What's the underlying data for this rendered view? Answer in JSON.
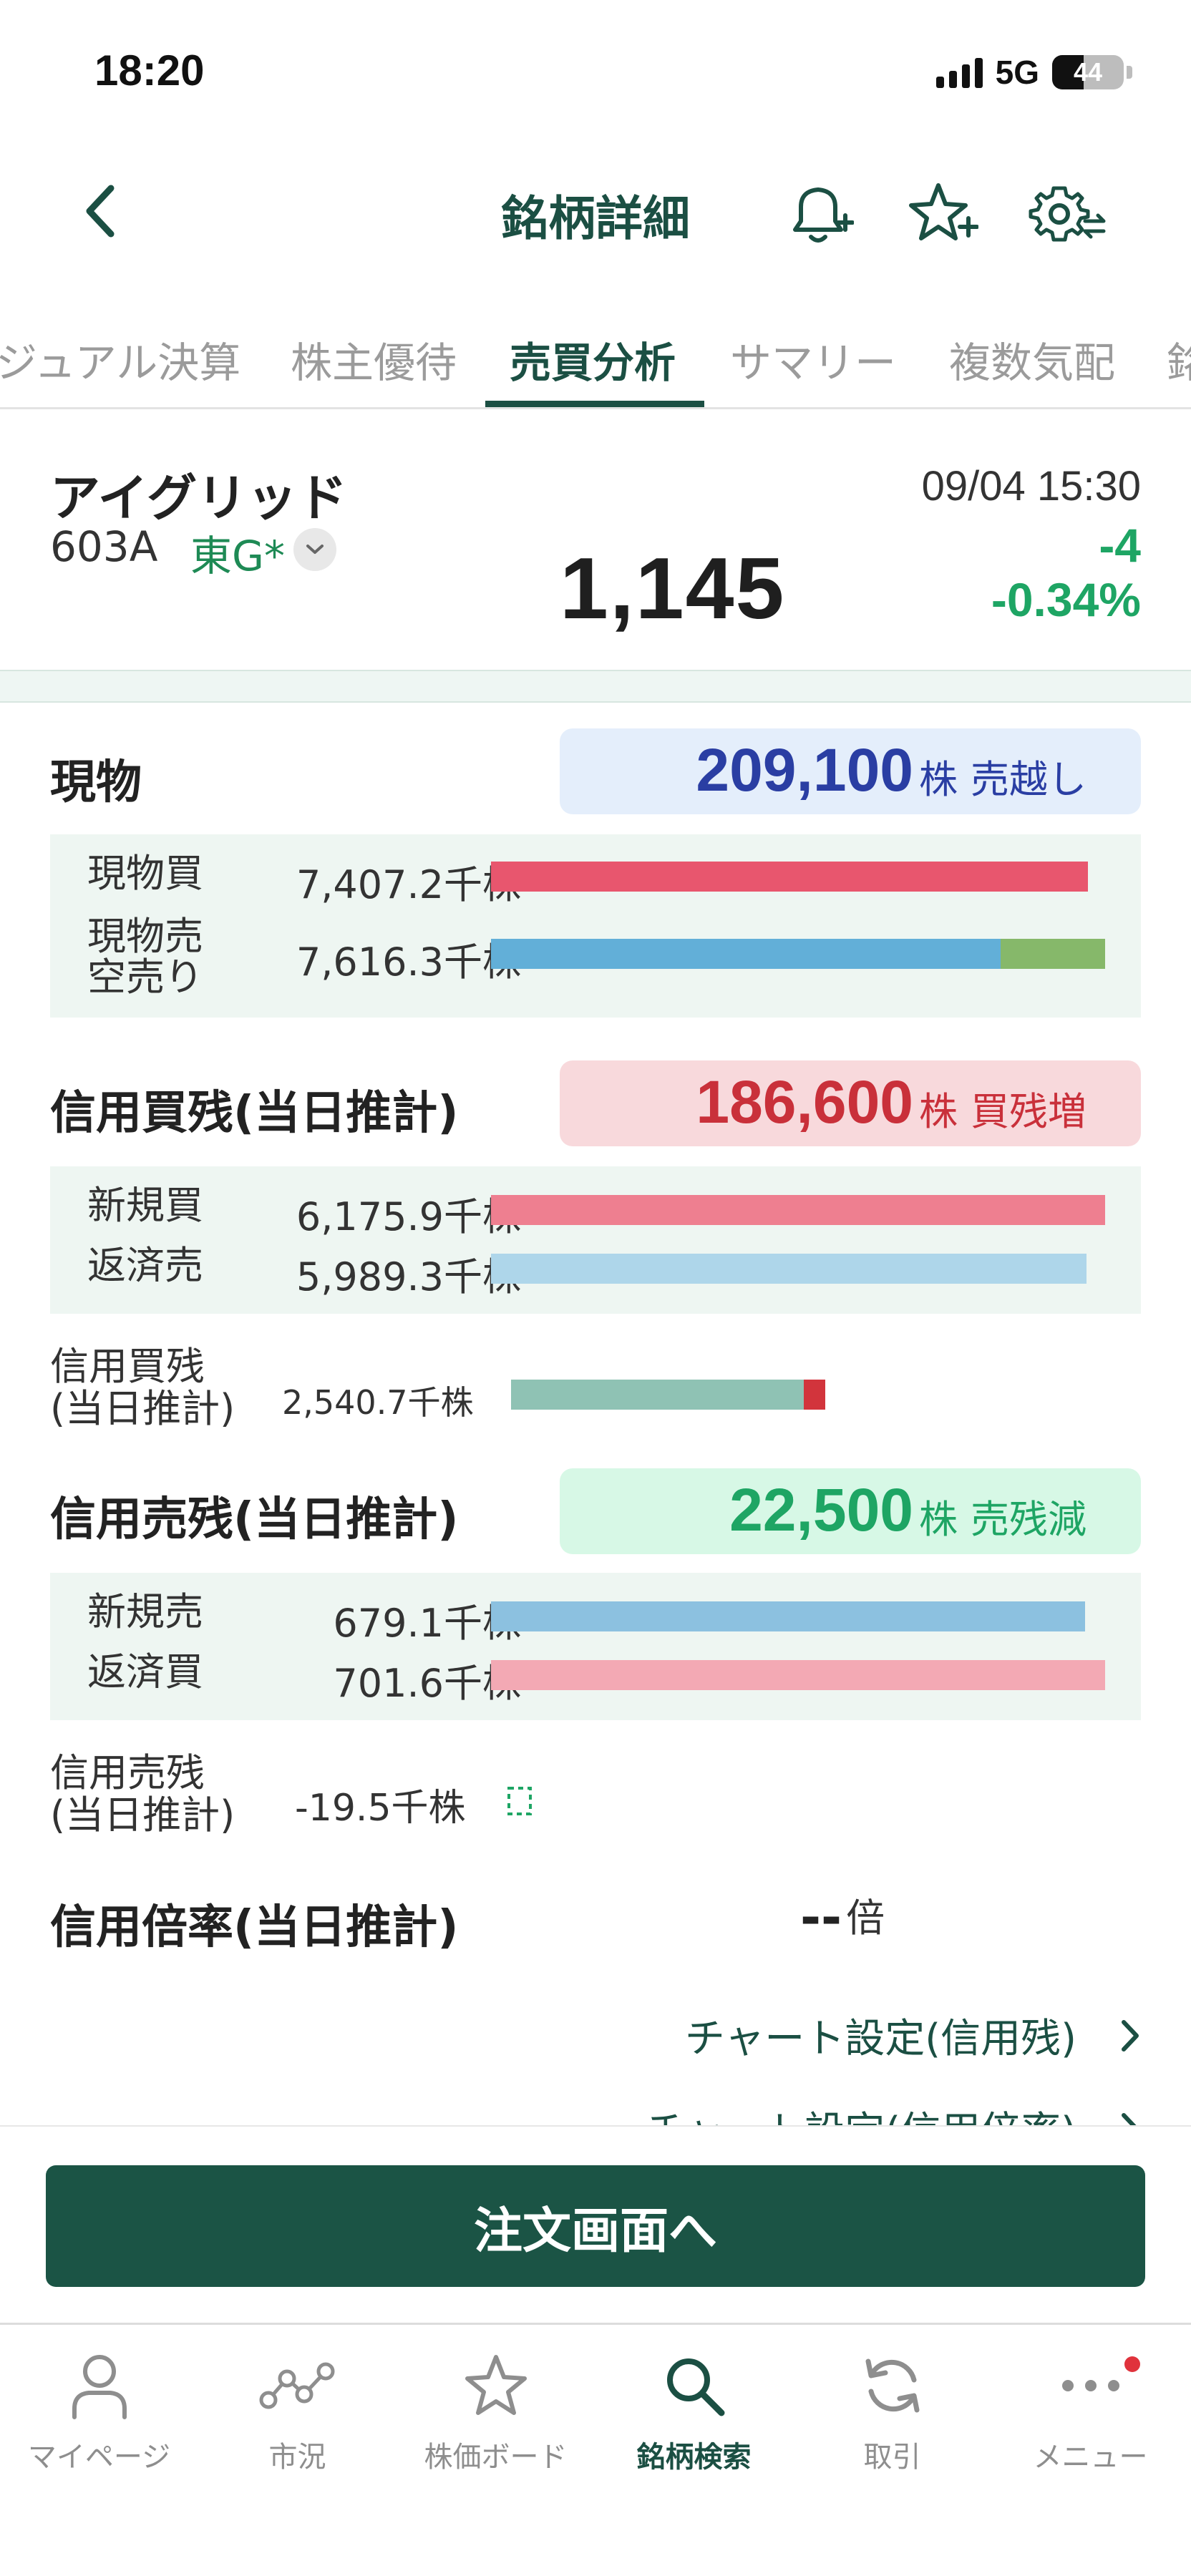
{
  "status": {
    "time": "18:20",
    "network": "5G",
    "battery": "44",
    "battery_level": 0.44
  },
  "header": {
    "title": "銘柄詳細",
    "icons": [
      "chevron-left-icon",
      "bell-plus-icon",
      "star-plus-icon",
      "gear-sync-icon"
    ]
  },
  "tabs": [
    {
      "label": "ジュアル決算",
      "active": false
    },
    {
      "label": "株主優待",
      "active": false
    },
    {
      "label": "売買分析",
      "active": true
    },
    {
      "label": "サマリー",
      "active": false
    },
    {
      "label": "複数気配",
      "active": false
    },
    {
      "label": "銘",
      "active": false
    }
  ],
  "stock": {
    "name": "アイグリッド",
    "code": "603A",
    "market": "東G*",
    "price": "1,145",
    "time": "09/04 15:30",
    "change": "-4",
    "change_pct": "-0.34%"
  },
  "genbutsu": {
    "title": "現物",
    "net": "209,100",
    "unit": "株",
    "state": "売越し",
    "buy_label": "現物買",
    "buy_value": "7,407.2千株",
    "buy_amount": 7407.2,
    "sell_label": "現物売\n空売り",
    "sell_value": "7,616.3千株",
    "sell_amount": 7616.3,
    "sell_short_fraction": 0.17
  },
  "margin_buy": {
    "title": "信用買残(当日推計)",
    "net": "186,600",
    "unit": "株",
    "state": "買残増",
    "new_label": "新規買",
    "new_value": "6,175.9千株",
    "new_amount": 6175.9,
    "repay_label": "返済売",
    "repay_value": "5,989.3千株",
    "repay_amount": 5989.3,
    "balance_label": "信用買残\n(当日推計)",
    "balance_value": "2,540.7千株",
    "balance_amount": 2540.7,
    "balance_increase": 186.6
  },
  "margin_sell": {
    "title": "信用売残(当日推計)",
    "net": "22,500",
    "unit": "株",
    "state": "売残減",
    "new_label": "新規売",
    "new_value": "679.1千株",
    "new_amount": 679.1,
    "repay_label": "返済買",
    "repay_value": "701.6千株",
    "repay_amount": 701.6,
    "balance_label": "信用売残\n(当日推計)",
    "balance_value": "-19.5千株"
  },
  "margin_ratio": {
    "title": "信用倍率(当日推計)",
    "value": "--",
    "unit": "倍"
  },
  "links": {
    "chart_margin_balance": "チャート設定(信用残)",
    "chart_margin_ratio": "チャート設定(信用倍率)"
  },
  "order_button": "注文画面へ",
  "nav": [
    {
      "label": "マイページ",
      "icon": "person-icon",
      "active": false
    },
    {
      "label": "市況",
      "icon": "market-network-icon",
      "active": false
    },
    {
      "label": "株価ボード",
      "icon": "star-icon",
      "active": false
    },
    {
      "label": "銘柄検索",
      "icon": "search-icon",
      "active": true
    },
    {
      "label": "取引",
      "icon": "refresh-icon",
      "active": false
    },
    {
      "label": "メニュー",
      "icon": "more-dots-icon",
      "active": false
    }
  ],
  "colors": {
    "brand": "#1b4f43",
    "green": "#1ea564",
    "red": "#c9303a",
    "blue": "#2a3ea3",
    "buy_bar": "#e8566e",
    "sell_bar": "#62afd8",
    "short_bar": "#86b86a",
    "new_buy_bar": "#ee7f90",
    "repay_sell_bar": "#aed6ea",
    "balance_bar": "#8fc2b4",
    "new_sell_bar": "#8cc1e0",
    "repay_buy_bar": "#f3a9b4"
  }
}
